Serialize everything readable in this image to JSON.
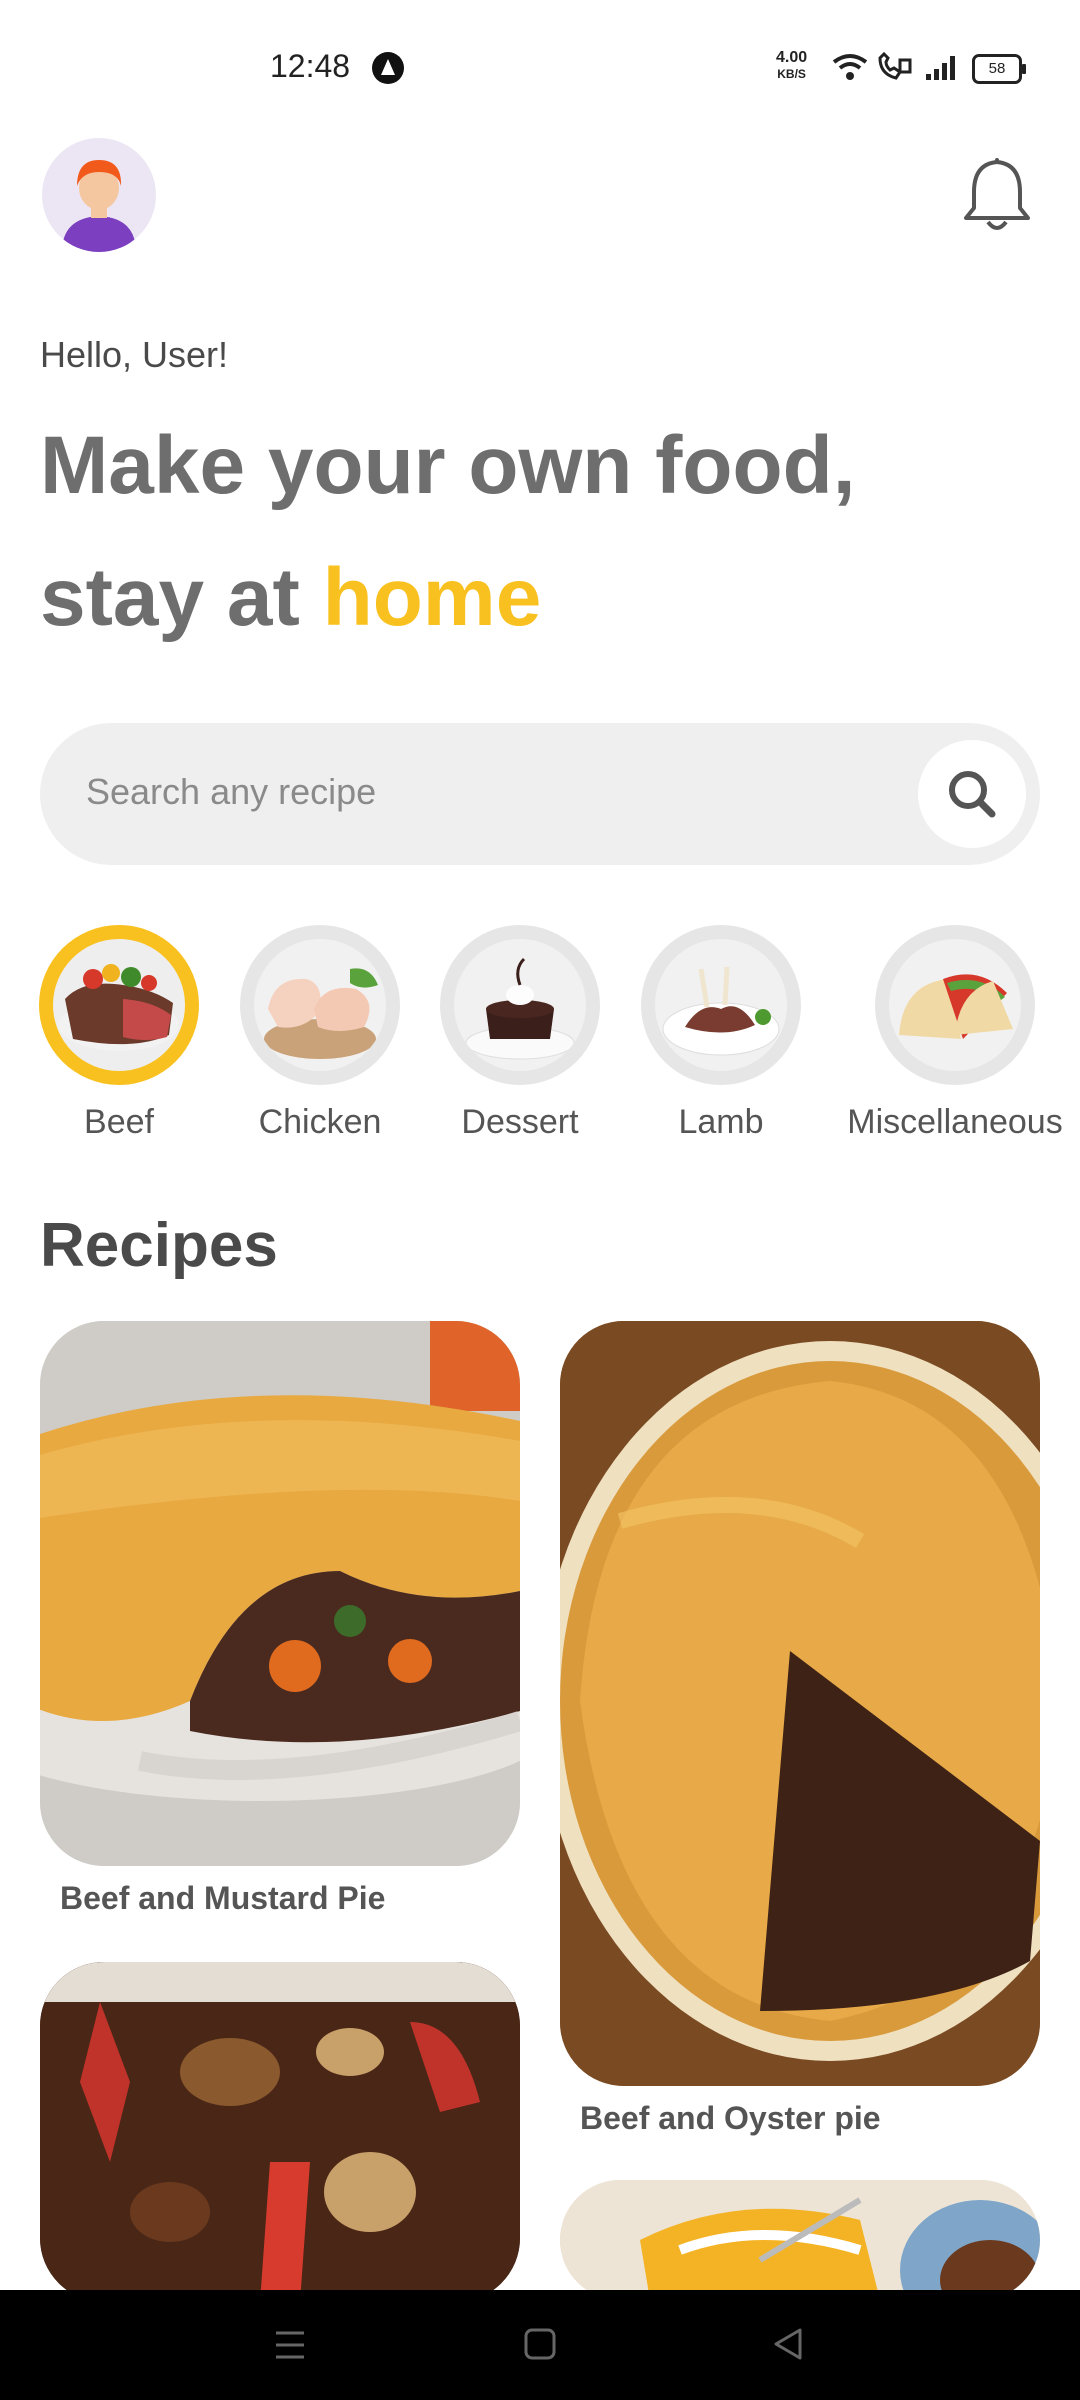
{
  "status_bar": {
    "time": "12:48",
    "net_speed": "4.00",
    "net_unit": "KB/S",
    "battery": "58"
  },
  "header": {
    "greeting": "Hello, User!",
    "headline_line1": "Make your own food,",
    "headline_line2_prefix": "stay at ",
    "headline_accent": "home"
  },
  "search": {
    "placeholder": "Search any recipe"
  },
  "categories": [
    {
      "label": "Beef",
      "active": true
    },
    {
      "label": "Chicken",
      "active": false
    },
    {
      "label": "Dessert",
      "active": false
    },
    {
      "label": "Lamb",
      "active": false
    },
    {
      "label": "Miscellaneous",
      "active": false
    }
  ],
  "recipes_section": {
    "title": "Recipes",
    "items": [
      {
        "name": "Beef and Mustard Pie"
      },
      {
        "name": "Beef and Oyster pie"
      },
      {
        "name": ""
      },
      {
        "name": ""
      }
    ]
  },
  "colors": {
    "accent": "#f9c11f",
    "text": "#555555",
    "search_bg": "#efefef"
  }
}
